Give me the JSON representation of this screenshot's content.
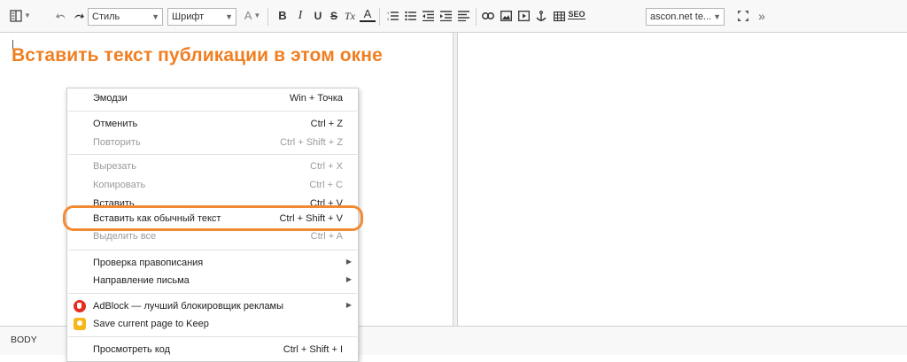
{
  "toolbar": {
    "style_combo": "Стиль",
    "font_combo": "Шрифт",
    "font_size_icon": "A",
    "bold": "B",
    "italic": "I",
    "underline": "U",
    "strike": "S",
    "remove_format": "Tx",
    "text_color": "A",
    "seo_button": "SEO",
    "template_combo": "ascon.net te...",
    "more": "»"
  },
  "editor": {
    "heading": "Вставить текст публикации в этом окне"
  },
  "statusbar": {
    "path": "BODY"
  },
  "context_menu": {
    "emoji_label": "Эмодзи",
    "emoji_shortcut": "Win + Точка",
    "undo_label": "Отменить",
    "undo_shortcut": "Ctrl + Z",
    "redo_label": "Повторить",
    "redo_shortcut": "Ctrl + Shift + Z",
    "cut_label": "Вырезать",
    "cut_shortcut": "Ctrl + X",
    "copy_label": "Копировать",
    "copy_shortcut": "Ctrl + C",
    "paste_label": "Вставить",
    "paste_shortcut": "Ctrl + V",
    "paste_plain_label": "Вставить как обычный текст",
    "paste_plain_shortcut": "Ctrl + Shift + V",
    "select_all_label": "Выделить все",
    "select_all_shortcut": "Ctrl + A",
    "spellcheck_label": "Проверка правописания",
    "direction_label": "Направление письма",
    "adblock_label": "AdBlock — лучший блокировщик рекламы",
    "keep_label": "Save current page to Keep",
    "inspect_label": "Просмотреть код",
    "inspect_shortcut": "Ctrl + Shift + I",
    "submenu_arrow": "▶"
  },
  "colors": {
    "heading": "#f07f21",
    "highlight": "#f28a34",
    "adblock_icon": "#e62e20",
    "keep_icon": "#f7b619"
  },
  "icons": [
    "source-view-icon",
    "undo-icon",
    "redo-icon",
    "font-size-icon",
    "numbered-list-icon",
    "bulleted-list-icon",
    "decrease-indent-icon",
    "increase-indent-icon",
    "align-icon",
    "link-icon",
    "image-icon",
    "media-icon",
    "anchor-icon",
    "table-icon",
    "seo-icon",
    "fullscreen-icon"
  ]
}
